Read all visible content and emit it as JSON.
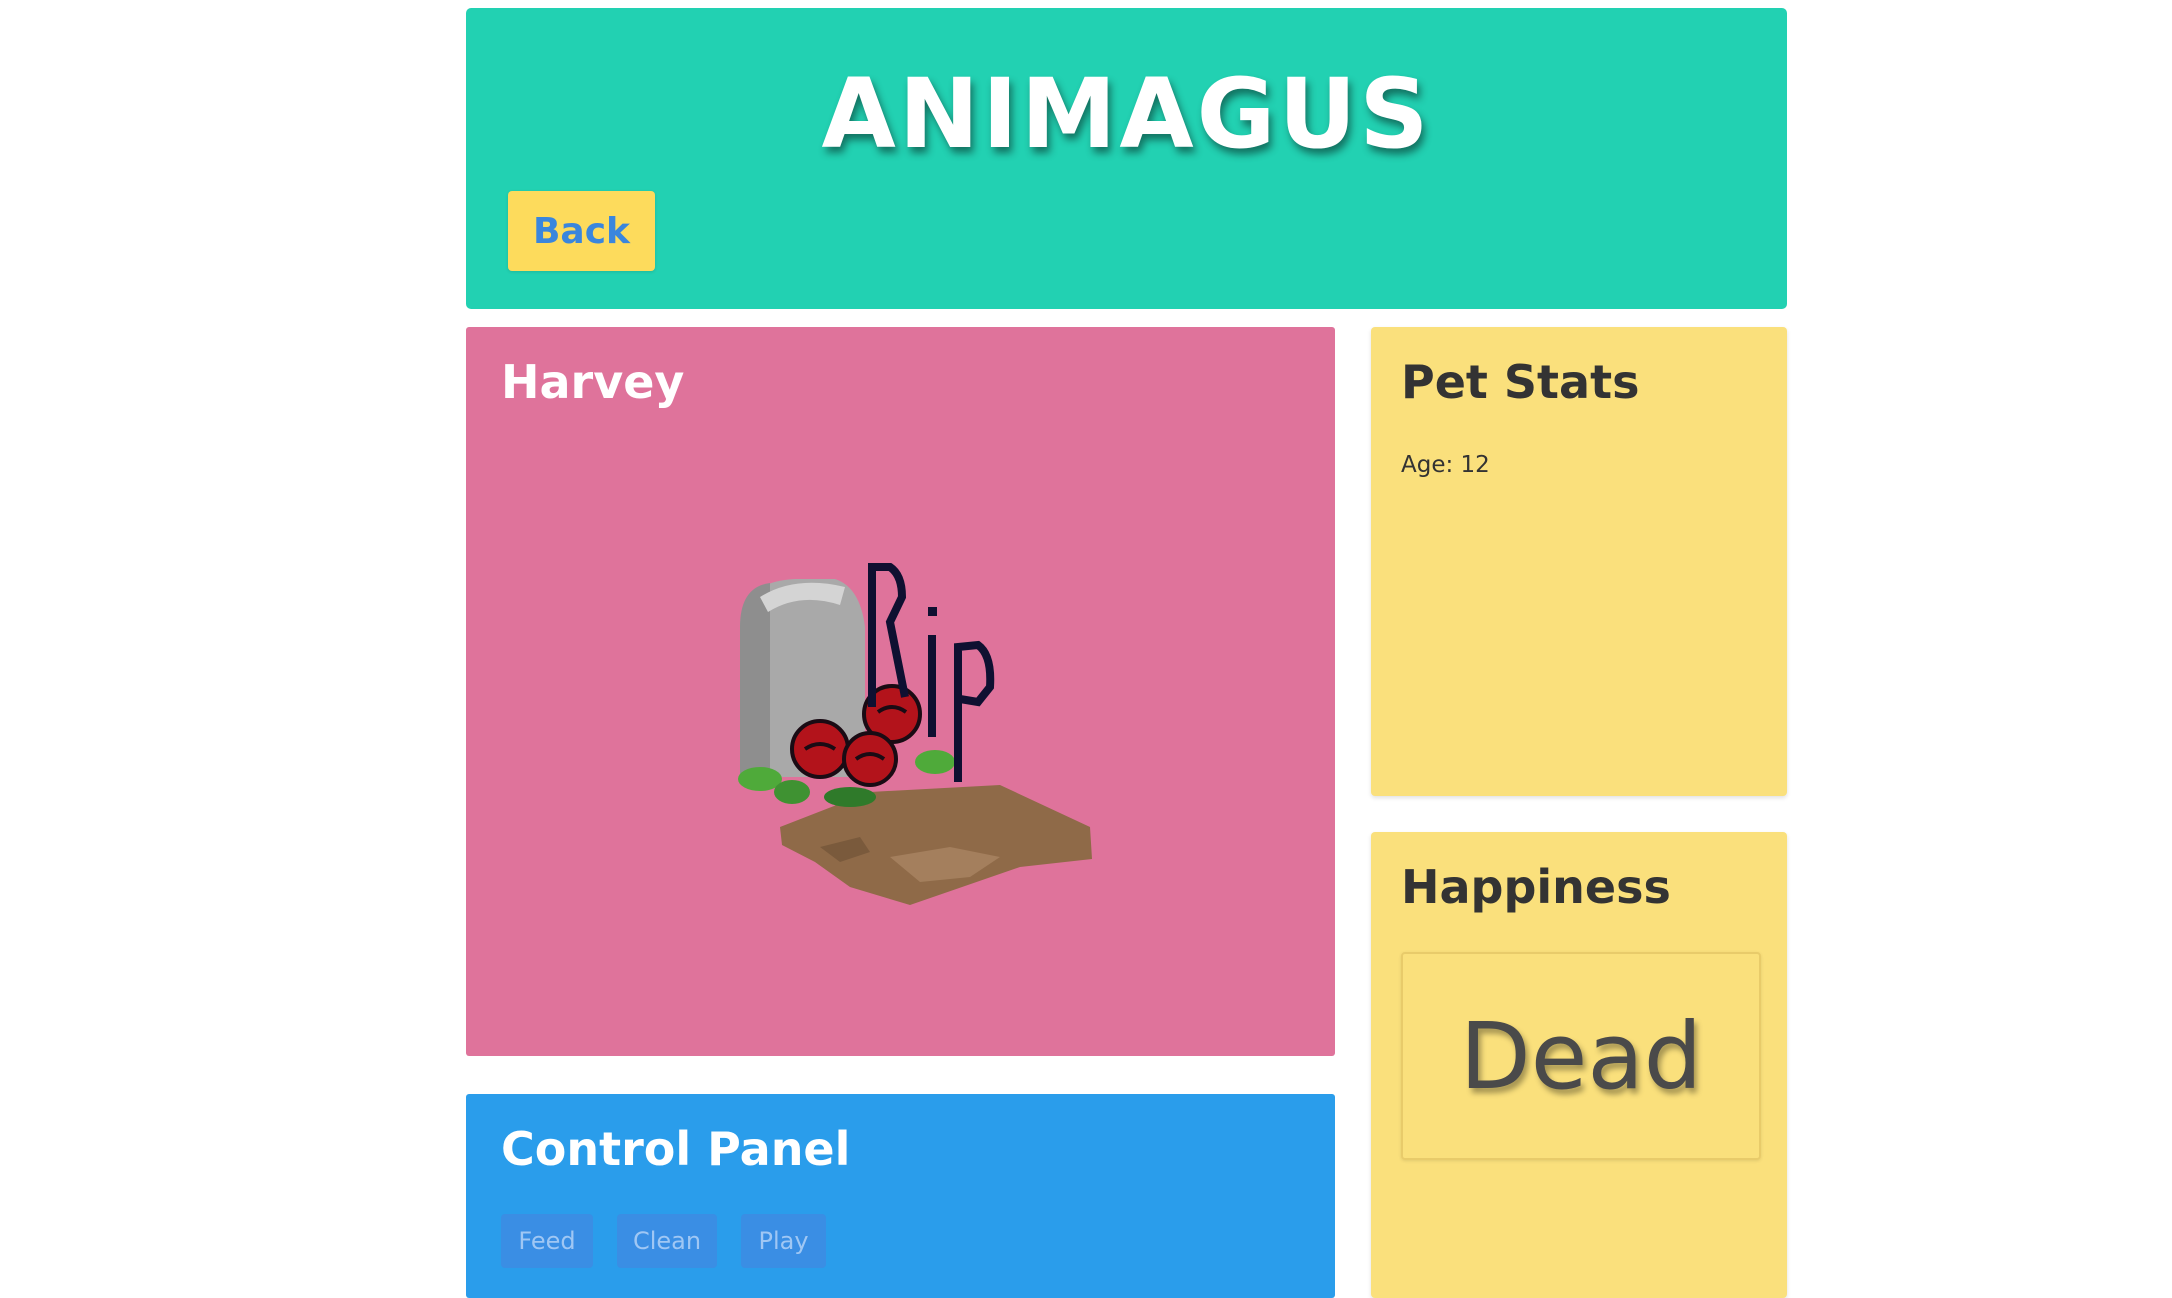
{
  "header": {
    "title": "ANIMAGUS",
    "back_label": "Back"
  },
  "pet": {
    "name": "Harvey",
    "image_icon": "tombstone-rip-icon",
    "image_text": "Rip"
  },
  "control_panel": {
    "title": "Control Panel",
    "buttons": [
      "Feed",
      "Clean",
      "Play"
    ]
  },
  "stats": {
    "title": "Pet Stats",
    "age": "Age: 12"
  },
  "happiness": {
    "title": "Happiness",
    "status": "Dead"
  },
  "colors": {
    "header_bg": "#22d1b2",
    "back_btn_bg": "#fddb5c",
    "pet_card_bg": "#df739b",
    "control_bg": "#2a9deb",
    "side_card_bg": "#fae07c"
  }
}
